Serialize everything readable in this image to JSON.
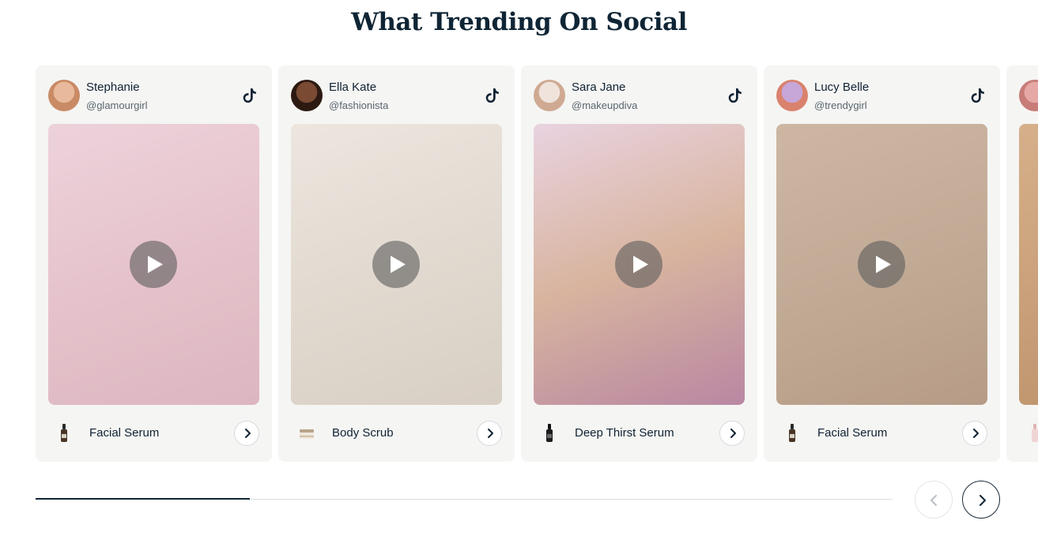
{
  "section": {
    "title": "What Trending On Social"
  },
  "cards": [
    {
      "name": "Stephanie",
      "handle": "@glamourgirl",
      "platform_icon": "tiktok-icon",
      "product": "Facial Serum",
      "product_icon": "serum-bottle-icon",
      "media_colors": [
        "#edd2db",
        "#e6c3cc",
        "#dcb6c0"
      ],
      "avatar_colors": [
        "#e8b99a",
        "#c98a66"
      ]
    },
    {
      "name": "Ella Kate",
      "handle": "@fashionista",
      "platform_icon": "tiktok-icon",
      "product": "Body Scrub",
      "product_icon": "scrub-jar-icon",
      "media_colors": [
        "#ece6df",
        "#e2dad0",
        "#d8cfc4"
      ],
      "avatar_colors": [
        "#7a4a33",
        "#2c1a12"
      ]
    },
    {
      "name": "Sara Jane",
      "handle": "@makeupdiva",
      "platform_icon": "tiktok-icon",
      "product": "Deep Thirst Serum",
      "product_icon": "serum-bottle-icon",
      "media_colors": [
        "#e9d3e0",
        "#d8b49f",
        "#b987a2"
      ],
      "avatar_colors": [
        "#efe3dc",
        "#cfa992"
      ]
    },
    {
      "name": "Lucy Belle",
      "handle": "@trendygirl",
      "platform_icon": "tiktok-icon",
      "product": "Facial Serum",
      "product_icon": "serum-bottle-icon",
      "media_colors": [
        "#cdb7a3",
        "#c2ab96",
        "#b69c86"
      ],
      "avatar_colors": [
        "#c7a6d8",
        "#d9826e"
      ]
    },
    {
      "name": "",
      "handle": "",
      "platform_icon": "tiktok-icon",
      "product": "",
      "product_icon": "serum-bottle-icon",
      "media_colors": [
        "#d6b08a",
        "#c9a07a",
        "#bb9169"
      ],
      "avatar_colors": [
        "#e6a8a4",
        "#c77c78"
      ]
    }
  ],
  "carousel": {
    "progress": 0.25
  },
  "controls": {
    "prev_icon": "chevron-left-icon",
    "next_icon": "chevron-right-icon"
  }
}
